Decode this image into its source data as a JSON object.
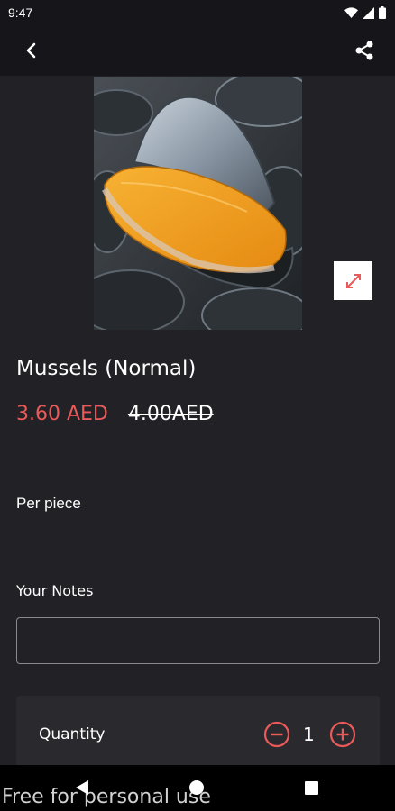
{
  "status_bar": {
    "time": "9:47",
    "icons": [
      "wifi-icon",
      "signal-icon",
      "battery-icon"
    ]
  },
  "app_bar": {
    "back_icon": "chevron-left-icon",
    "share_icon": "share-icon"
  },
  "product": {
    "image_alt": "Mussels",
    "expand_icon": "expand-icon",
    "title": "Mussels (Normal)",
    "price_current": "3.60 AED",
    "price_old": "4.00AED",
    "unit": "Per piece"
  },
  "notes": {
    "label": "Your Notes",
    "value": "",
    "placeholder": ""
  },
  "quantity": {
    "label": "Quantity",
    "value": "1"
  },
  "nav_bar": {
    "icons": [
      "back-triangle-icon",
      "home-circle-icon",
      "recents-square-icon"
    ]
  },
  "watermark": "Free for personal use",
  "colors": {
    "accent": "#ea5a5a",
    "background": "#222226",
    "app_bar": "#16161a"
  }
}
